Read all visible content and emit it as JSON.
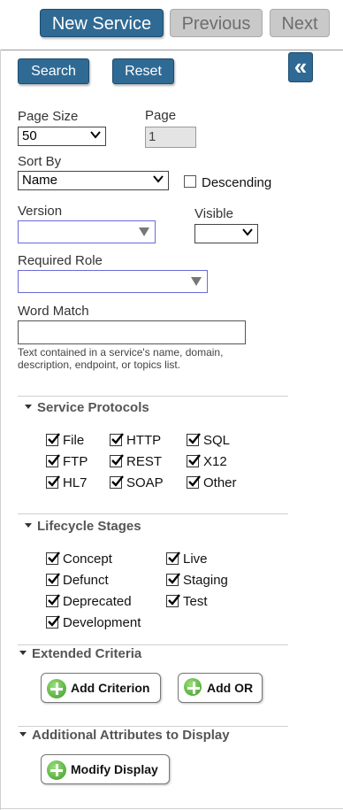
{
  "toolbar": {
    "new_service": "New Service",
    "previous": "Previous",
    "next": "Next"
  },
  "search": {
    "search_label": "Search",
    "reset_label": "Reset",
    "collapse_glyph": "«"
  },
  "fields": {
    "page_size_label": "Page Size",
    "page_size_value": "50",
    "page_label": "Page",
    "page_value": "1",
    "sort_by_label": "Sort By",
    "sort_by_value": "Name",
    "descending_label": "Descending",
    "version_label": "Version",
    "visible_label": "Visible",
    "required_role_label": "Required Role",
    "word_match_label": "Word Match",
    "word_match_value": "",
    "word_match_help": "Text contained in a service's name, domain, description, endpoint, or topics list."
  },
  "protocols": {
    "title": "Service Protocols",
    "items": [
      "File",
      "HTTP",
      "SQL",
      "FTP",
      "REST",
      "X12",
      "HL7",
      "SOAP",
      "Other"
    ]
  },
  "lifecycle": {
    "title": "Lifecycle Stages",
    "items": [
      "Concept",
      "Live",
      "Defunct",
      "Staging",
      "Deprecated",
      "Test",
      "Development"
    ]
  },
  "extended": {
    "title": "Extended Criteria",
    "add_criterion": "Add Criterion",
    "add_or": "Add OR"
  },
  "attributes": {
    "title": "Additional Attributes to Display",
    "modify_display": "Modify Display"
  },
  "colors": {
    "primary": "#2f6a94",
    "disabled": "#c9c9c9",
    "focus_border": "#6b6bd6"
  }
}
